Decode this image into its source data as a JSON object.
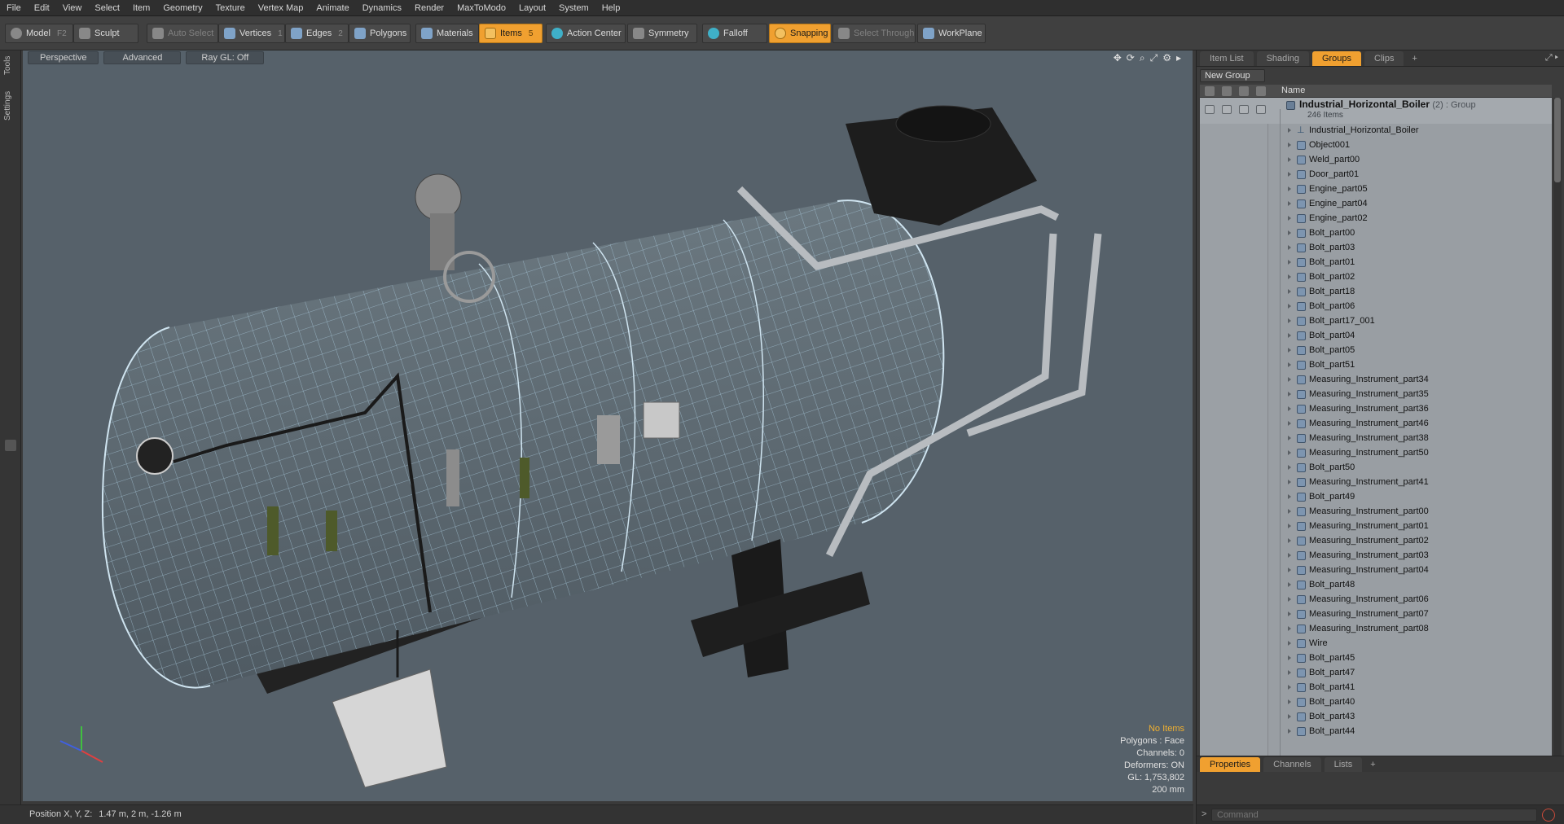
{
  "menu": [
    "File",
    "Edit",
    "View",
    "Select",
    "Item",
    "Geometry",
    "Texture",
    "Vertex Map",
    "Animate",
    "Dynamics",
    "Render",
    "MaxToModo",
    "Layout",
    "System",
    "Help"
  ],
  "toolbar": {
    "model": "Model",
    "model_key": "F2",
    "sculpt": "Sculpt",
    "auto_select": "Auto Select",
    "vertices": "Vertices",
    "vertices_key": "1",
    "edges": "Edges",
    "edges_key": "2",
    "polygons": "Polygons",
    "materials": "Materials",
    "items": "Items",
    "items_key": "5",
    "action_center": "Action Center",
    "symmetry": "Symmetry",
    "falloff": "Falloff",
    "snapping": "Snapping",
    "select_through": "Select Through",
    "workplane": "WorkPlane"
  },
  "left_tabs": [
    "Tools",
    "Settings"
  ],
  "viewport": {
    "view": "Perspective",
    "advanced": "Advanced",
    "raygl": "Ray GL: Off",
    "stats": {
      "no_items": "No Items",
      "polygons": "Polygons : Face",
      "channels": "Channels: 0",
      "deformers": "Deformers: ON",
      "gl": "GL: 1,753,802",
      "scale": "200 mm"
    }
  },
  "status": {
    "label": "Position X, Y, Z:",
    "value": "1.47 m, 2 m, -1.26 m"
  },
  "right_panel": {
    "tabs": [
      "Item List",
      "Shading",
      "Groups",
      "Clips"
    ],
    "active_tab": "Groups",
    "new_group": "New Group",
    "col_name": "Name",
    "group": {
      "name": "Industrial_Horizontal_Boiler",
      "meta": "(2) : Group",
      "count": "246 Items"
    },
    "items": [
      "Industrial_Horizontal_Boiler",
      "Object001",
      "Weld_part00",
      "Door_part01",
      "Engine_part05",
      "Engine_part04",
      "Engine_part02",
      "Bolt_part00",
      "Bolt_part03",
      "Bolt_part01",
      "Bolt_part02",
      "Bolt_part18",
      "Bolt_part06",
      "Bolt_part17_001",
      "Bolt_part04",
      "Bolt_part05",
      "Bolt_part51",
      "Measuring_Instrument_part34",
      "Measuring_Instrument_part35",
      "Measuring_Instrument_part36",
      "Measuring_Instrument_part46",
      "Measuring_Instrument_part38",
      "Measuring_Instrument_part50",
      "Bolt_part50",
      "Measuring_Instrument_part41",
      "Bolt_part49",
      "Measuring_Instrument_part00",
      "Measuring_Instrument_part01",
      "Measuring_Instrument_part02",
      "Measuring_Instrument_part03",
      "Measuring_Instrument_part04",
      "Bolt_part48",
      "Measuring_Instrument_part06",
      "Measuring_Instrument_part07",
      "Measuring_Instrument_part08",
      "Wire",
      "Bolt_part45",
      "Bolt_part47",
      "Bolt_part41",
      "Bolt_part40",
      "Bolt_part43",
      "Bolt_part44"
    ],
    "bottom_tabs": [
      "Properties",
      "Channels",
      "Lists"
    ],
    "bottom_active": "Properties",
    "command_placeholder": "Command"
  }
}
